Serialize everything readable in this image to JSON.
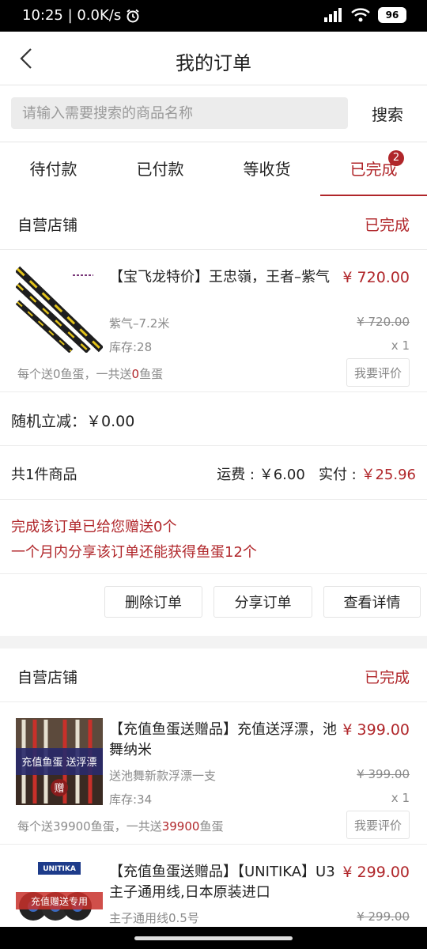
{
  "status_bar": {
    "time_speed": "10:25 | 0.0K/s",
    "battery": "96"
  },
  "header": {
    "title": "我的订单"
  },
  "search": {
    "placeholder": "请输入需要搜索的商品名称",
    "button": "搜索"
  },
  "tabs": [
    {
      "label": "待付款"
    },
    {
      "label": "已付款"
    },
    {
      "label": "等收货"
    },
    {
      "label": "已完成",
      "badge": "2",
      "active": true
    }
  ],
  "orders": [
    {
      "shop": "自营店铺",
      "status": "已完成",
      "items": [
        {
          "title": "【宝飞龙特价】王忠嶺，王者–紫气",
          "price": "¥ 720.00",
          "spec": "紫气–7.2米",
          "old_price": "¥ 720.00",
          "stock": "库存:28",
          "qty": "x 1",
          "gift_prefix": "每个送0鱼蛋，一共送",
          "gift_total": "0",
          "gift_suffix": "鱼蛋",
          "review": "我要评价"
        }
      ],
      "discount": "随机立减：￥0.00",
      "count": "共1件商品",
      "shipping": "运费 : ￥6.00",
      "paid_label": "实付 : ",
      "paid_value": "￥25.96",
      "notice_1": "完成该订单已给您赠送0个",
      "notice_2": "一个月内分享该订单还能获得鱼蛋12个",
      "actions": [
        "删除订单",
        "分享订单",
        "查看详情"
      ]
    },
    {
      "shop": "自营店铺",
      "status": "已完成",
      "items": [
        {
          "title": "【充值鱼蛋送赠品】充值送浮漂，池舞纳米",
          "price": "¥ 399.00",
          "spec": "送池舞新款浮漂一支",
          "old_price": "¥ 399.00",
          "stock": "库存:34",
          "qty": "x 1",
          "gift_prefix": "每个送39900鱼蛋，一共送",
          "gift_total": "39900",
          "gift_suffix": "鱼蛋",
          "review": "我要评价",
          "thumb_text": "充值鱼蛋 送浮漂",
          "thumb_stamp": "赠"
        },
        {
          "title": "【充值鱼蛋送赠品】【UNITIKA】U3主子通用线,日本原装进口",
          "price": "¥ 299.00",
          "spec": "主子通用线0.5号",
          "old_price": "¥ 299.00",
          "thumb_brand": "UNITIKA",
          "thumb_text": "充值赠送专用"
        }
      ]
    }
  ]
}
